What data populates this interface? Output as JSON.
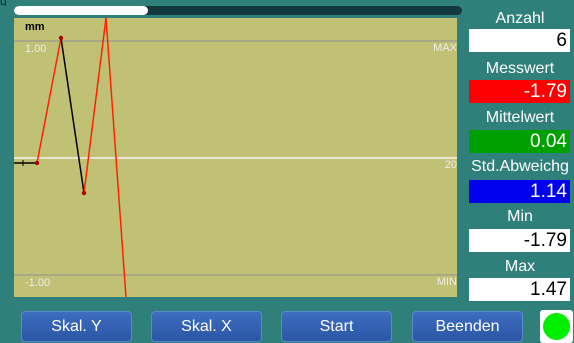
{
  "top": {
    "fragment": "g",
    "progress_fraction": 0.3
  },
  "plot": {
    "unit": "mm",
    "y_upper": "1.00",
    "y_lower": "-1.00",
    "max_label": "MAX",
    "min_label": "MIN",
    "mid_label": "20"
  },
  "stats": {
    "anzahl_title": "Anzahl",
    "anzahl_value": "6",
    "messwert_title": "Messwert",
    "messwert_value": "-1.79",
    "mittelwert_title": "Mittelwert",
    "mittelwert_value": "0.04",
    "std_title": "Std.Abweichg",
    "std_value": "1.14",
    "min_title": "Min",
    "min_value": "-1.79",
    "max_title": "Max",
    "max_value": "1.47"
  },
  "colors": {
    "background": "#2f7f7b",
    "plot": "#c0c174",
    "messwert": "#ff0000",
    "mittelwert": "#00a000",
    "std": "#0000ee",
    "trace": "#ff2200",
    "indicator": "#00ee00"
  },
  "buttons": {
    "skal_y": "Skal. Y",
    "skal_x": "Skal. X",
    "start": "Start",
    "beenden": "Beenden"
  },
  "indicator": {
    "icon": "status-led-icon",
    "state": "ok"
  }
}
